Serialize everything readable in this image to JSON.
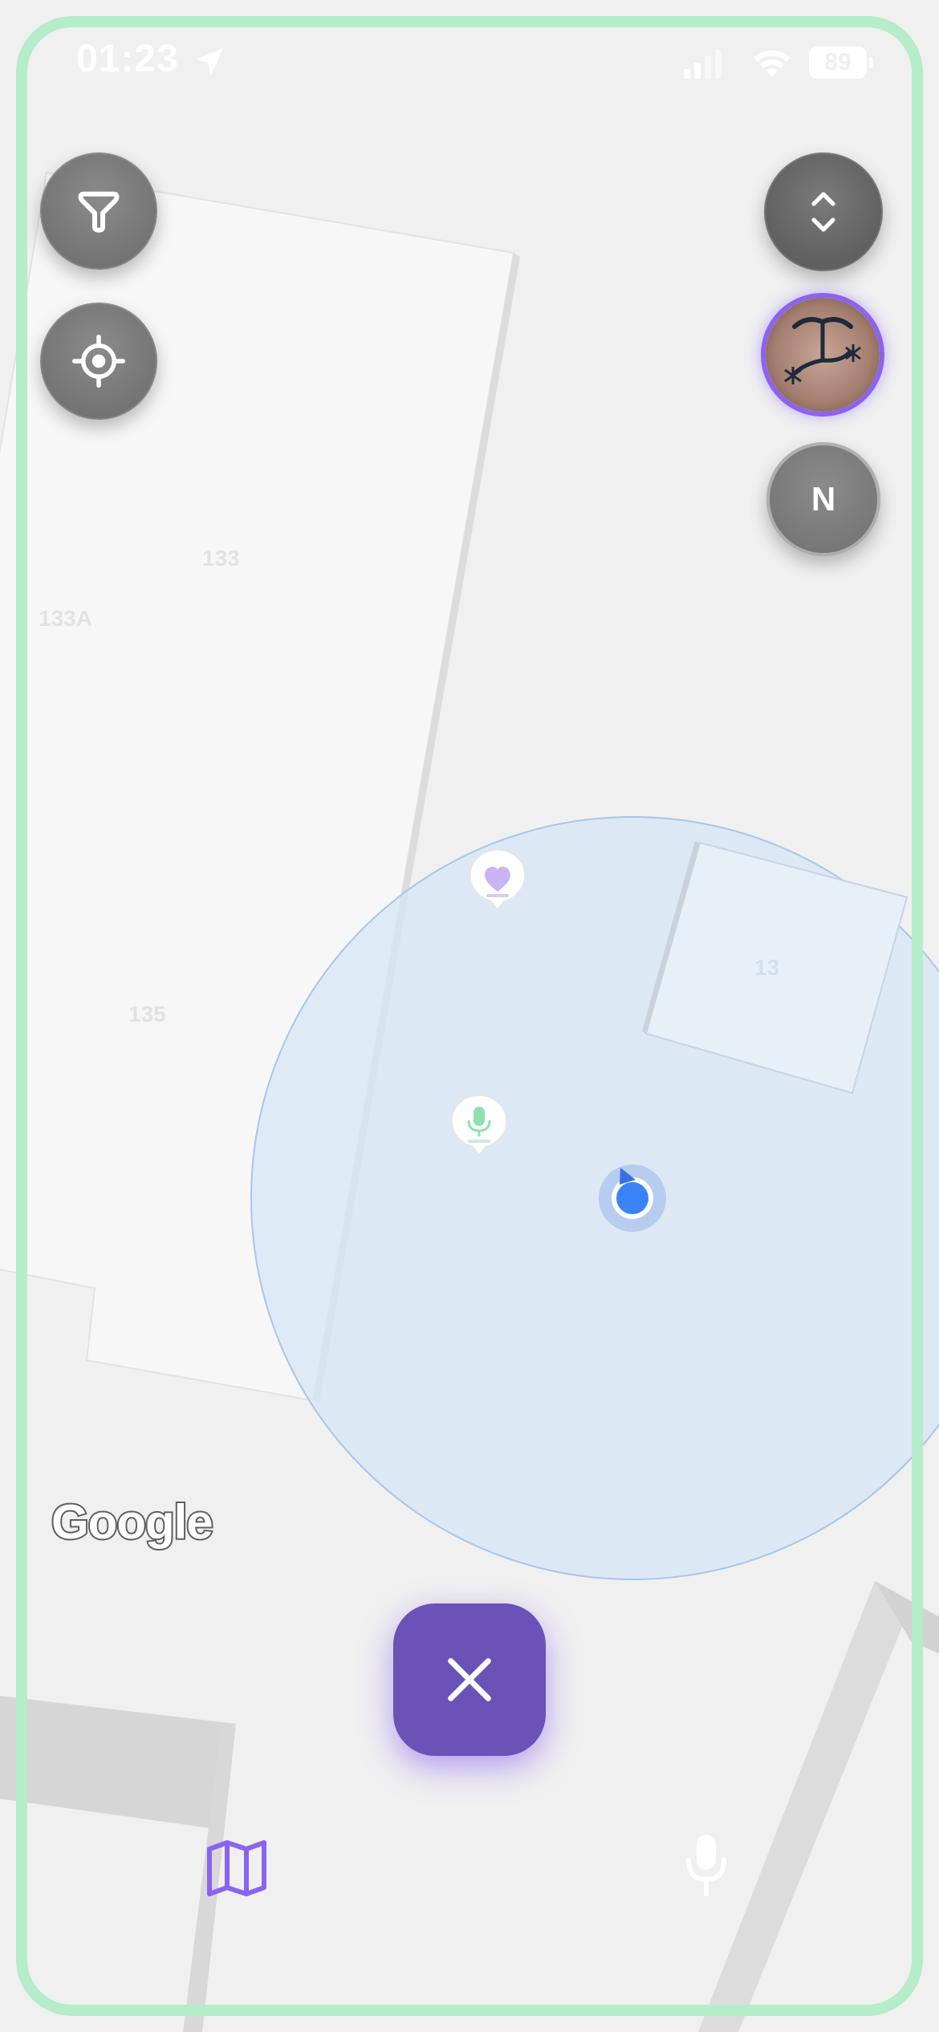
{
  "status_bar": {
    "time": "01:23",
    "battery": "89",
    "icons": [
      "location-arrow-icon",
      "cellular-signal-icon",
      "wifi-icon",
      "battery-icon"
    ]
  },
  "map": {
    "building_labels": [
      "133",
      "133A",
      "135",
      "13"
    ],
    "attribution": "Google",
    "accuracy_circle_color": "#d6e6f6",
    "user_location_color": "#3b82f6"
  },
  "controls": {
    "filter_icon": "filter-icon",
    "recenter_icon": "crosshair-icon",
    "expand_icon": "chevron-up-down-icon",
    "compass_label": "N",
    "avatar_accent": "#8a63f0"
  },
  "pins": [
    {
      "icon": "heart-icon",
      "color": "#c9b3f5"
    },
    {
      "icon": "microphone-icon",
      "color": "#8fe0b0"
    }
  ],
  "actions": {
    "close_icon": "close-icon",
    "close_color": "#6a52b7"
  },
  "bottom_nav": {
    "items": [
      "map-icon",
      "microphone-icon"
    ],
    "active_color": "#8a63f0"
  },
  "frame": {
    "border_color": "#b5ecca"
  }
}
